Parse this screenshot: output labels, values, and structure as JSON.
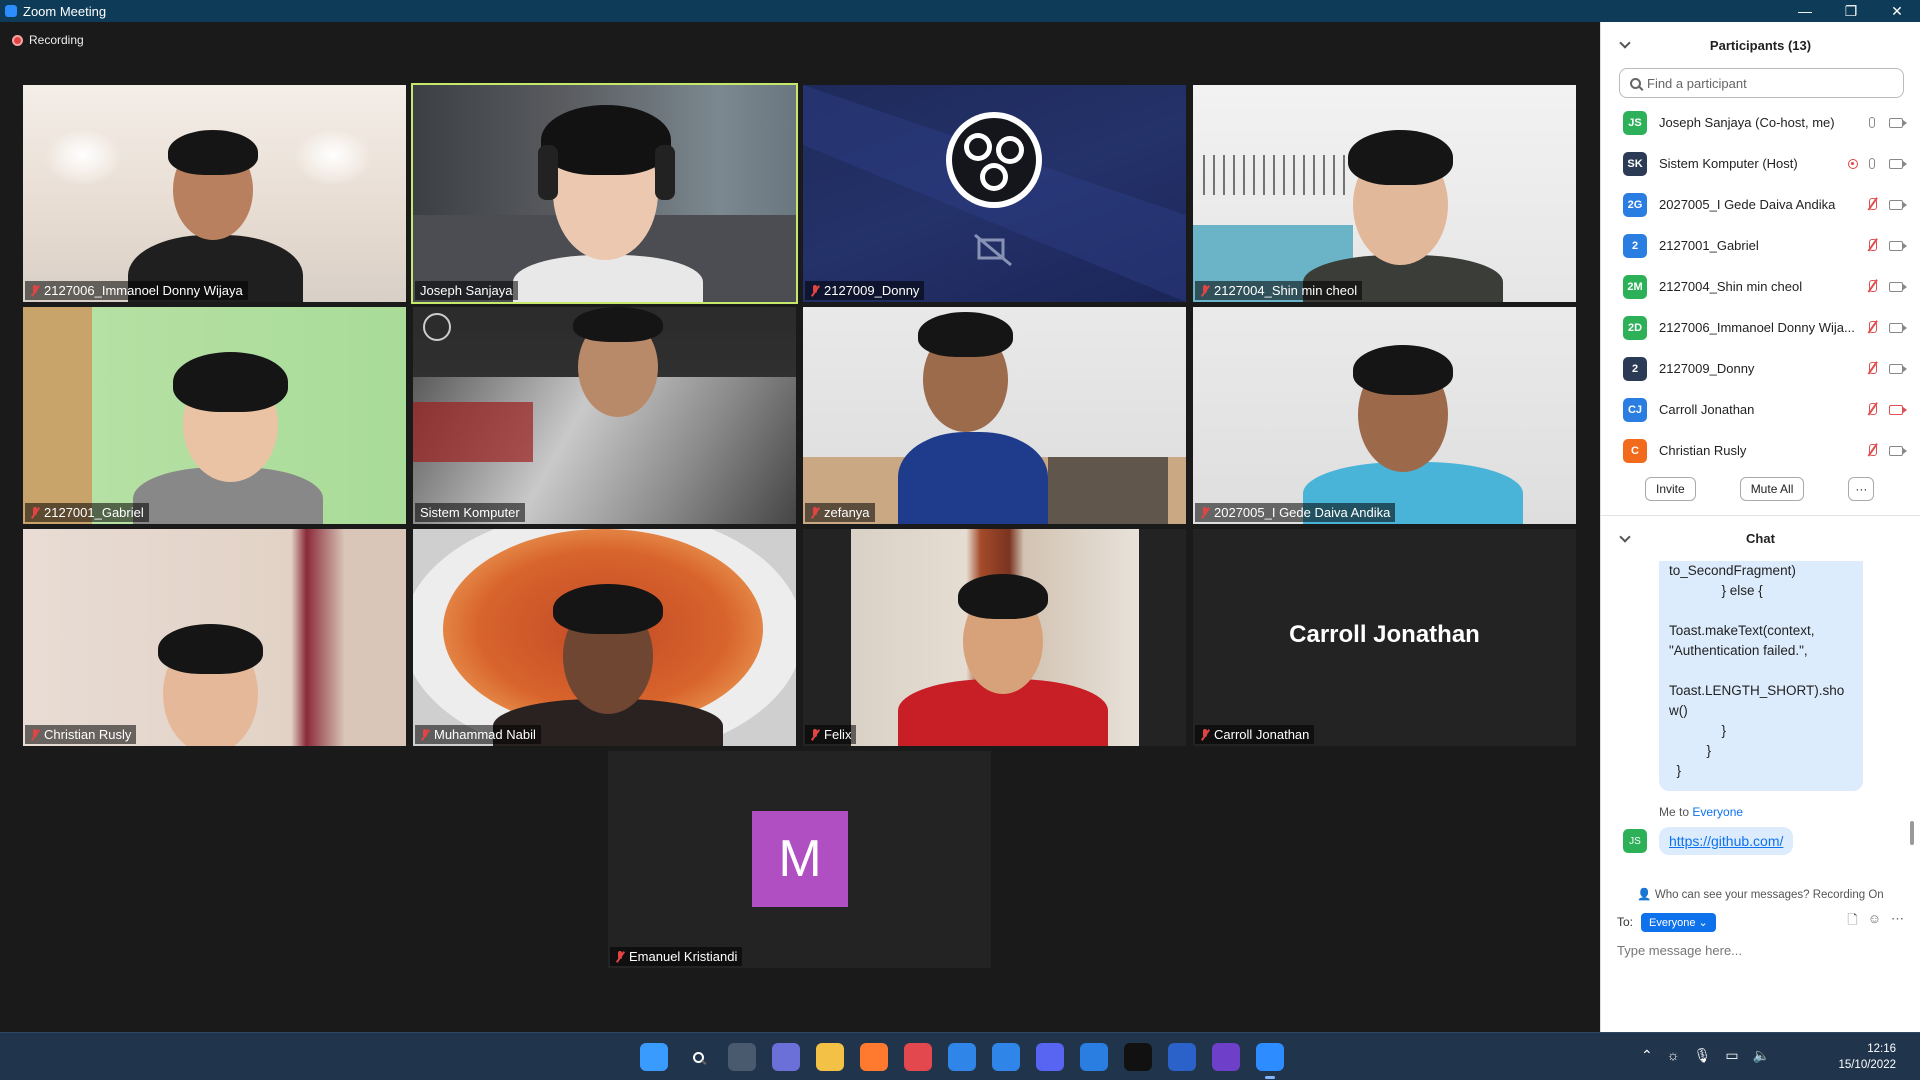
{
  "window": {
    "title": "Zoom Meeting",
    "minimize": "—",
    "restore": "❐",
    "close": "✕"
  },
  "recording": {
    "label": "Recording"
  },
  "tiles": [
    {
      "name": "2127006_Immanoel Donny Wijaya",
      "muted": true
    },
    {
      "name": "Joseph Sanjaya",
      "muted": false,
      "active": true
    },
    {
      "name": "2127009_Donny",
      "muted": true
    },
    {
      "name": "2127004_Shin min cheol",
      "muted": true
    },
    {
      "name": "2127001_Gabriel",
      "muted": true
    },
    {
      "name": "Sistem Komputer",
      "muted": false
    },
    {
      "name": "zefanya",
      "muted": true
    },
    {
      "name": "2027005_I Gede Daiva Andika",
      "muted": true
    },
    {
      "name": "Christian Rusly",
      "muted": true
    },
    {
      "name": "Muhammad Nabil",
      "muted": true
    },
    {
      "name": "Felix",
      "muted": true
    },
    {
      "name": "Carroll Jonathan",
      "muted": true,
      "display_name": "Carroll Jonathan"
    },
    {
      "name": "Emanuel Kristiandi",
      "muted": true,
      "avatar_letter": "M"
    }
  ],
  "participants": {
    "title": "Participants (13)",
    "search_placeholder": "Find a participant",
    "list": [
      {
        "initials": "JS",
        "color": "#2db158",
        "name": "Joseph Sanjaya (Co-host, me)",
        "mic": "on",
        "cam": "on"
      },
      {
        "initials": "SK",
        "color": "#2b3a55",
        "name": "Sistem Komputer (Host)",
        "mic": "on",
        "cam": "on",
        "recording": true
      },
      {
        "initials": "2G",
        "color": "#2a7de1",
        "name": "2027005_I Gede Daiva Andika",
        "mic": "off",
        "cam": "on"
      },
      {
        "initials": "2",
        "color": "#2a7de1",
        "name": "2127001_Gabriel",
        "mic": "off",
        "cam": "on"
      },
      {
        "initials": "2M",
        "color": "#2db158",
        "name": "2127004_Shin min cheol",
        "mic": "off",
        "cam": "on"
      },
      {
        "initials": "2D",
        "color": "#2db158",
        "name": "2127006_Immanoel Donny Wija...",
        "mic": "off",
        "cam": "on"
      },
      {
        "initials": "2",
        "color": "#2b3a55",
        "name": "2127009_Donny",
        "mic": "off",
        "cam": "on"
      },
      {
        "initials": "CJ",
        "color": "#2a7de1",
        "name": "Carroll Jonathan",
        "mic": "off",
        "cam": "off"
      },
      {
        "initials": "C",
        "color": "#f26a1b",
        "name": "Christian Rusly",
        "mic": "off",
        "cam": "on"
      }
    ],
    "invite": "Invite",
    "mute_all": "Mute All",
    "more": "···"
  },
  "chat": {
    "title": "Chat",
    "code_message": "to_SecondFragment)\n              } else {\n\nToast.makeText(context,\n\"Authentication failed.\",\n\nToast.LENGTH_SHORT).sho\nw()\n              }\n          }\n  }",
    "meta_prefix": "Me to ",
    "meta_target": "Everyone",
    "my_initials": "JS",
    "link": "https://github.com/",
    "visibility": "Who can see your messages? Recording On",
    "to_label": "To:",
    "to_value": "Everyone ⌄",
    "placeholder": "Type message here..."
  },
  "taskbar": {
    "apps": [
      {
        "icon": "windows-start-icon",
        "color": "#3a9bff"
      },
      {
        "icon": "search-icon",
        "color": "transparent"
      },
      {
        "icon": "task-view-icon",
        "color": "#4a5a6e"
      },
      {
        "icon": "teams-chat-icon",
        "color": "#6b6fd8"
      },
      {
        "icon": "file-explorer-icon",
        "color": "#f3c145"
      },
      {
        "icon": "firefox-icon",
        "color": "#ff7a2e"
      },
      {
        "icon": "game-icon",
        "color": "#e4484f"
      },
      {
        "icon": "mail-icon",
        "color": "#2f86e8"
      },
      {
        "icon": "calendar-icon",
        "color": "#2f86e8"
      },
      {
        "icon": "discord-icon",
        "color": "#5865f2"
      },
      {
        "icon": "store-icon",
        "color": "#2a7de1"
      },
      {
        "icon": "webstorm-icon",
        "color": "#111111"
      },
      {
        "icon": "word-icon",
        "color": "#2b62c9"
      },
      {
        "icon": "github-desktop-icon",
        "color": "#6e40c9"
      },
      {
        "icon": "zoom-icon",
        "color": "#2d8cff"
      }
    ],
    "time": "12:16",
    "date": "15/10/2022"
  }
}
